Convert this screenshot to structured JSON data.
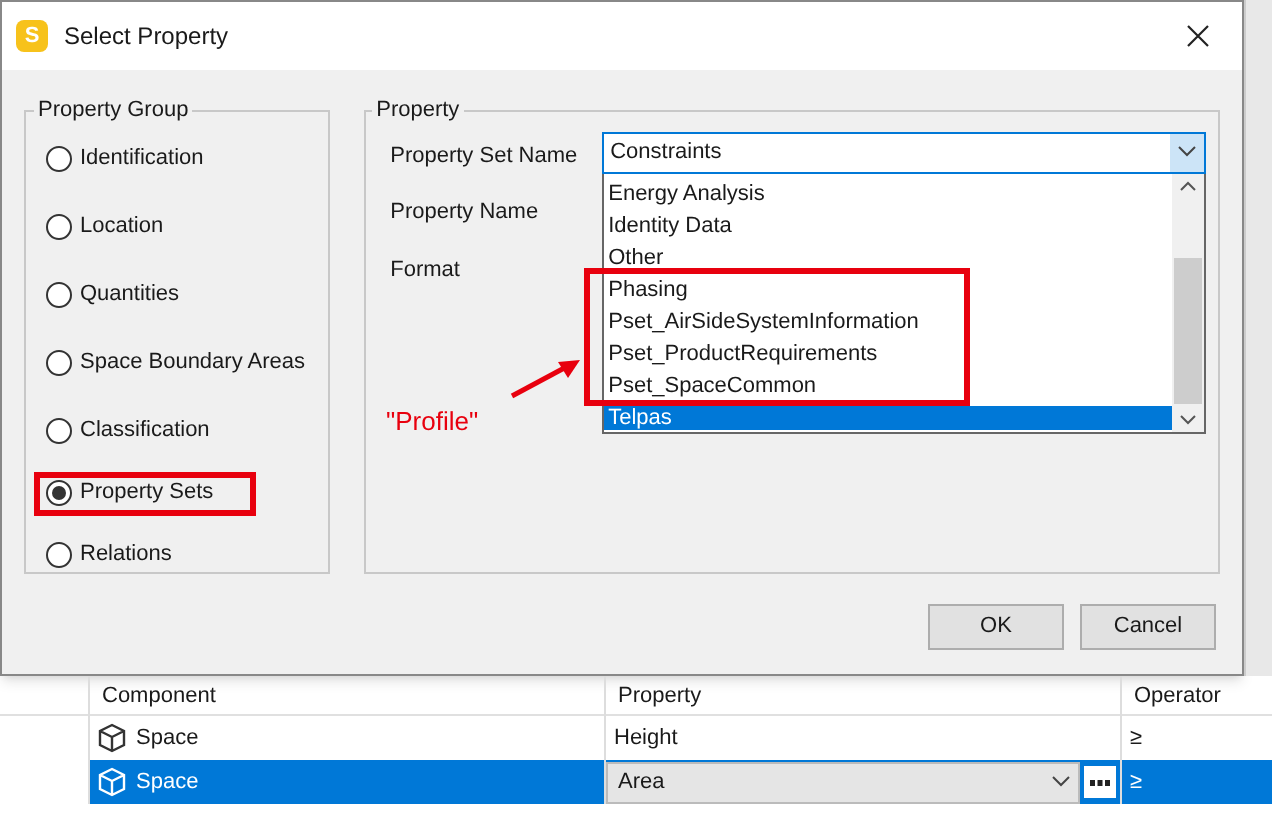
{
  "window": {
    "title": "Select Property",
    "app_letter": "S"
  },
  "property_group": {
    "title": "Property Group",
    "options": [
      {
        "label": "Identification",
        "selected": false
      },
      {
        "label": "Location",
        "selected": false
      },
      {
        "label": "Quantities",
        "selected": false
      },
      {
        "label": "Space Boundary Areas",
        "selected": false
      },
      {
        "label": "Classification",
        "selected": false
      },
      {
        "label": "Property Sets",
        "selected": true
      },
      {
        "label": "Relations",
        "selected": false
      }
    ]
  },
  "property": {
    "title": "Property",
    "fields": [
      "Property Set Name",
      "Property Name",
      "Format"
    ],
    "property_set_name": {
      "value": "Constraints",
      "expanded": true,
      "items": [
        {
          "label": "Energy Analysis",
          "selected": false
        },
        {
          "label": "Identity Data",
          "selected": false
        },
        {
          "label": "Other",
          "selected": false
        },
        {
          "label": "Phasing",
          "selected": false
        },
        {
          "label": "Pset_AirSideSystemInformation",
          "selected": false
        },
        {
          "label": "Pset_ProductRequirements",
          "selected": false
        },
        {
          "label": "Pset_SpaceCommon",
          "selected": false
        },
        {
          "label": "Telpas",
          "selected": true
        }
      ]
    }
  },
  "buttons": [
    "OK",
    "Cancel"
  ],
  "annotation": {
    "label": "\"Profile\""
  },
  "table": {
    "columns": [
      "Component",
      "Property",
      "Operator"
    ],
    "rows": [
      {
        "component": "Space",
        "property": "Height",
        "operator": "≥",
        "selected": false,
        "editing": false
      },
      {
        "component": "Space",
        "property": "Area",
        "operator": "≥",
        "selected": true,
        "editing": true
      }
    ]
  }
}
